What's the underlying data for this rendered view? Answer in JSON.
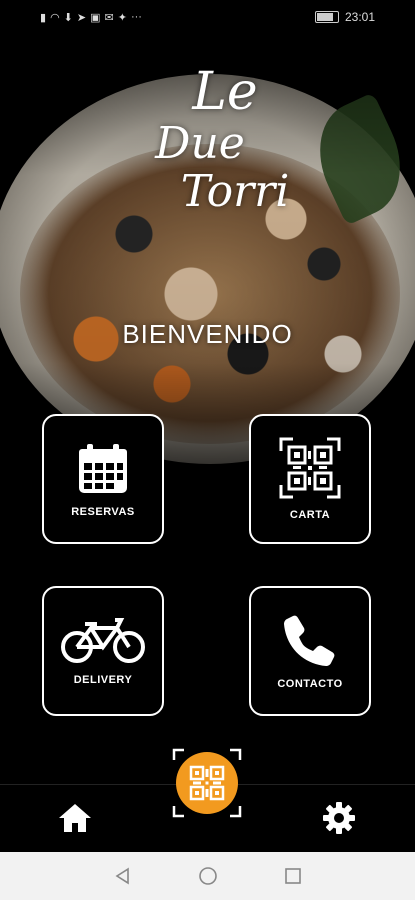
{
  "status_bar": {
    "time": "23:01",
    "left_icons": [
      "sim-icon",
      "wifi-icon",
      "download-icon",
      "telegram-icon",
      "image-icon",
      "mail-icon",
      "twitter-icon"
    ],
    "more": "···"
  },
  "hero": {
    "logo_lines": [
      "Le",
      "Due",
      "Torri"
    ],
    "welcome": "BIENVENIDO"
  },
  "tiles": [
    {
      "label": "RESERVAS",
      "icon": "calendar-icon"
    },
    {
      "label": "CARTA",
      "icon": "qr-code-icon"
    },
    {
      "label": "DELIVERY",
      "icon": "bicycle-icon"
    },
    {
      "label": "CONTACTO",
      "icon": "phone-icon"
    }
  ],
  "bottom_nav": {
    "home_icon": "home-icon",
    "center_icon": "qr-scan-icon",
    "settings_icon": "gear-icon"
  },
  "colors": {
    "accent": "#f29a1f",
    "background": "#000000",
    "tile_border": "#ffffff"
  }
}
